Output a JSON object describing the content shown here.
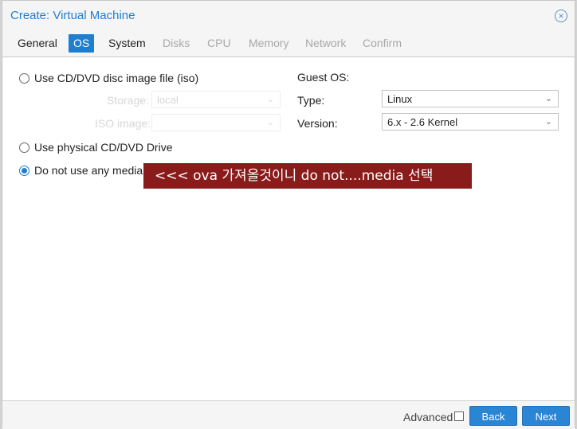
{
  "dialog": {
    "title": "Create: Virtual Machine",
    "close_icon": "×"
  },
  "tabs": [
    {
      "label": "General",
      "state": "normal"
    },
    {
      "label": "OS",
      "state": "active"
    },
    {
      "label": "System",
      "state": "normal"
    },
    {
      "label": "Disks",
      "state": "disabled"
    },
    {
      "label": "CPU",
      "state": "disabled"
    },
    {
      "label": "Memory",
      "state": "disabled"
    },
    {
      "label": "Network",
      "state": "disabled"
    },
    {
      "label": "Confirm",
      "state": "disabled"
    }
  ],
  "media": {
    "iso_option": "Use CD/DVD disc image file (iso)",
    "storage_label": "Storage:",
    "storage_value": "local",
    "iso_image_label": "ISO image:",
    "iso_image_value": "",
    "physical_option": "Use physical CD/DVD Drive",
    "none_option": "Do not use any media",
    "selected": "none"
  },
  "guest_os": {
    "heading": "Guest OS:",
    "type_label": "Type:",
    "type_value": "Linux",
    "version_label": "Version:",
    "version_value": "6.x - 2.6 Kernel"
  },
  "annotation": {
    "text": "<<< ova 가져올것이니 do not....media 선택",
    "background": "#8a1b1b"
  },
  "footer": {
    "advanced_label": "Advanced",
    "advanced_checked": false,
    "back_label": "Back",
    "next_label": "Next"
  },
  "colors": {
    "accent": "#1f7ed0",
    "button": "#2a85d5"
  },
  "icons": {
    "dropdown": "chevron-down-icon",
    "close": "close-icon"
  }
}
